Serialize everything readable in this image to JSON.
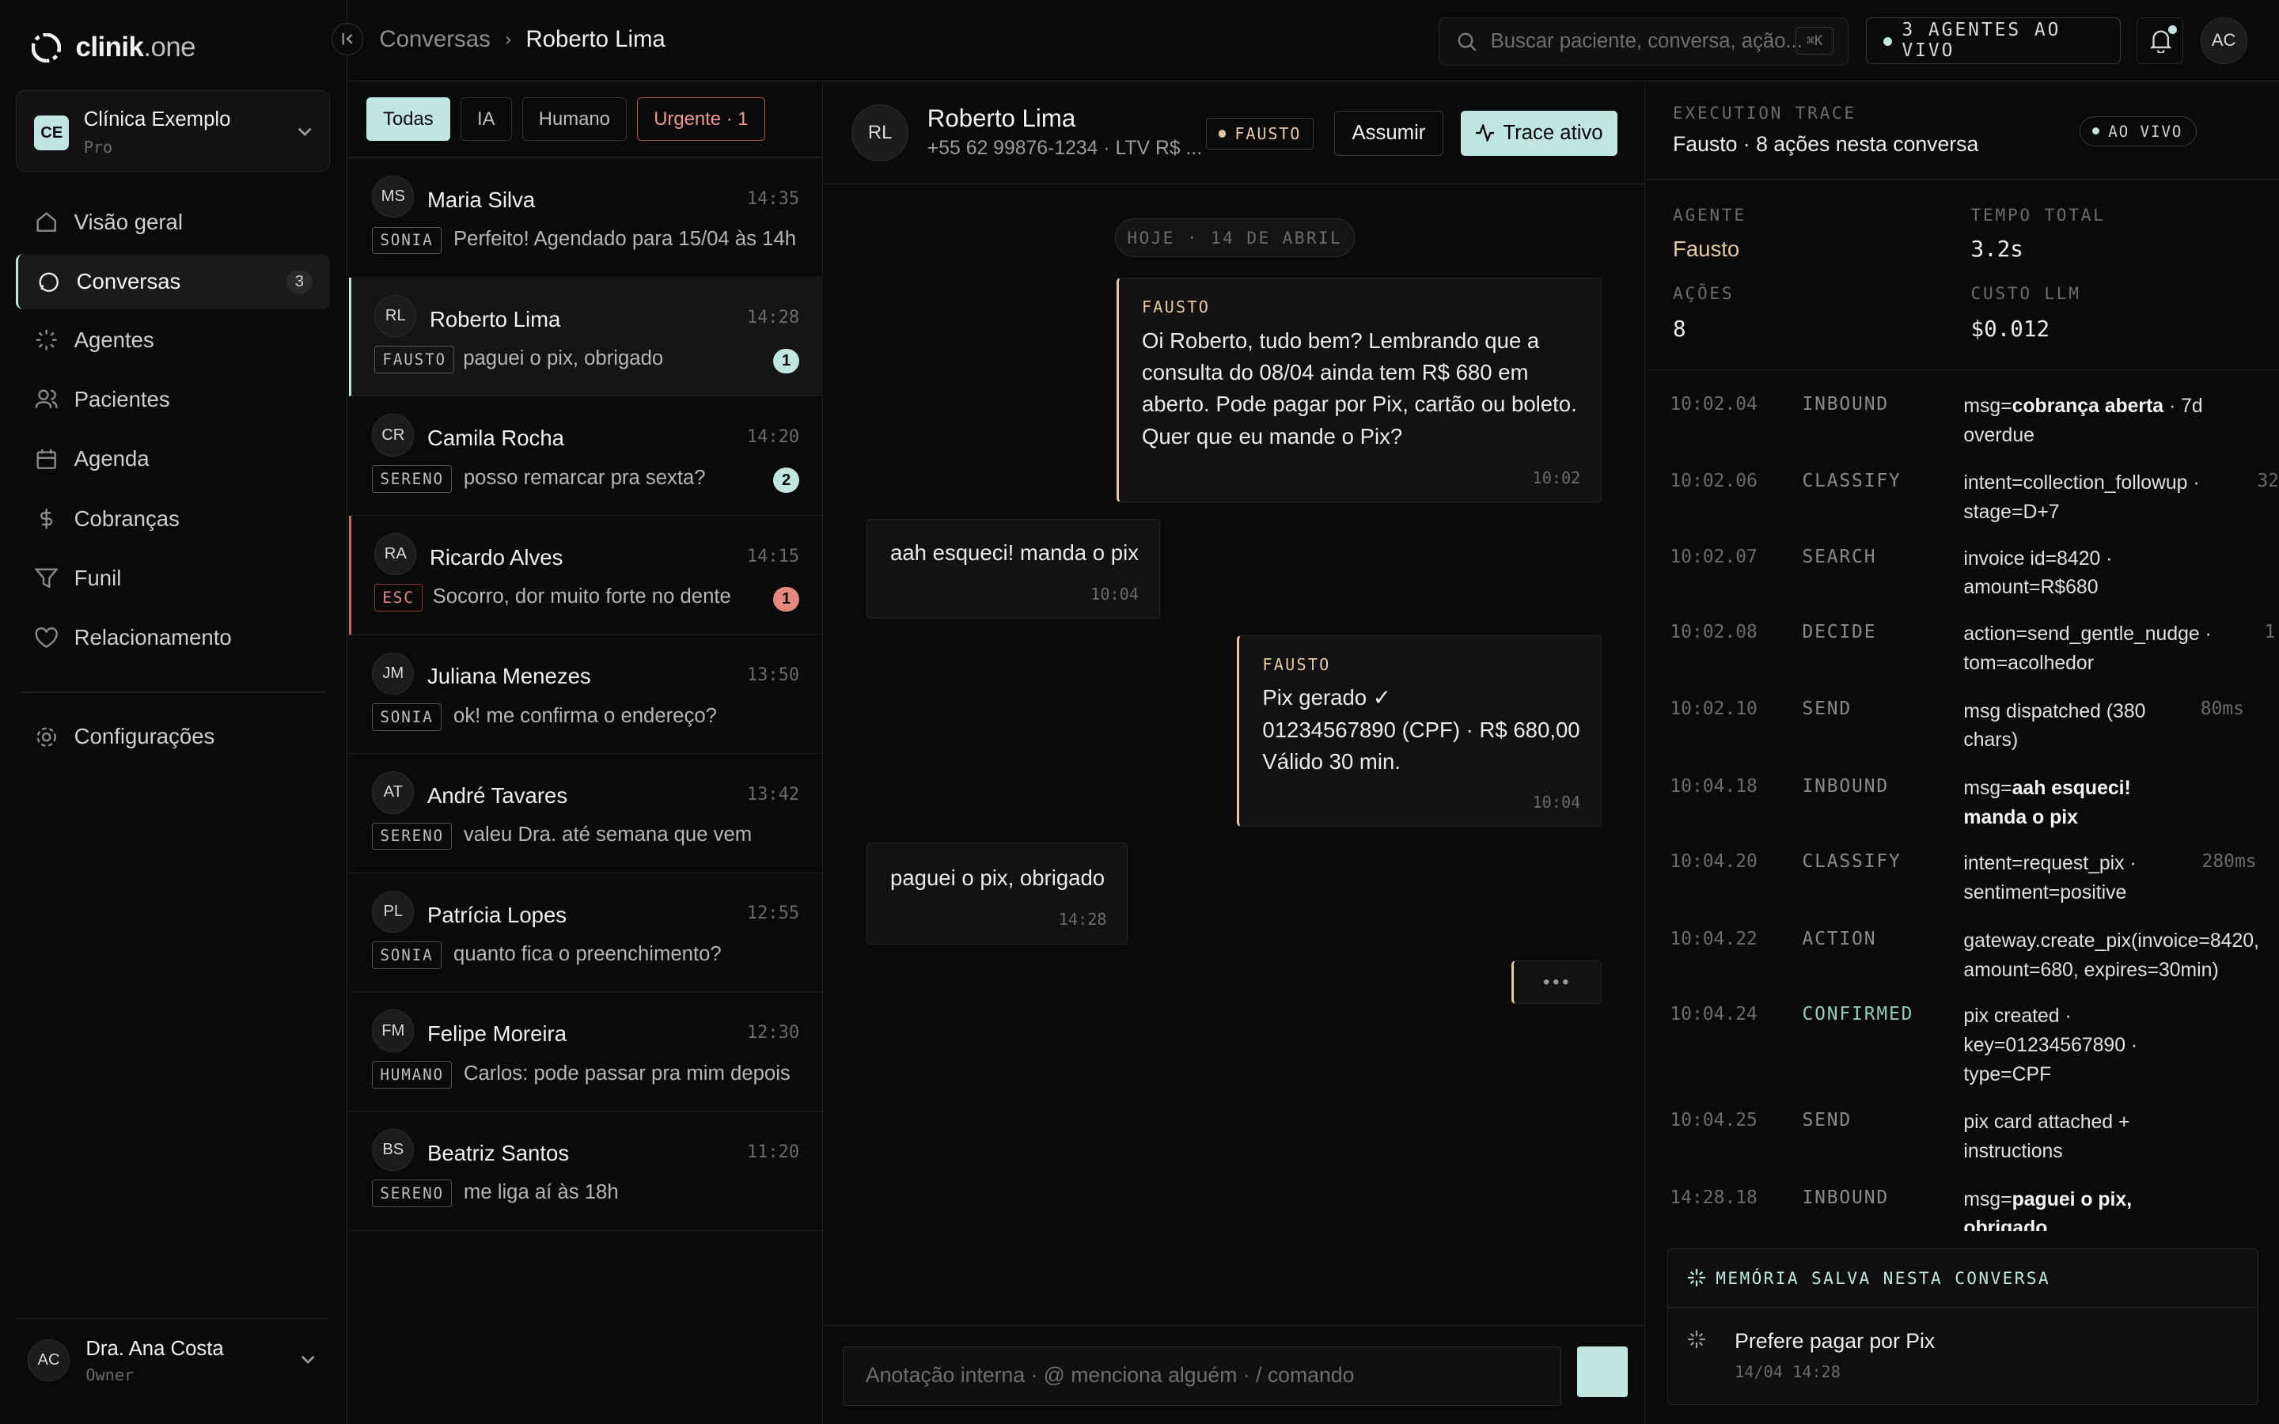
{
  "app": {
    "logo_bold": "clinik",
    "logo_light": ".one"
  },
  "clinic": {
    "initials": "CE",
    "name": "Clínica Exemplo",
    "plan": "Pro"
  },
  "nav": [
    {
      "label": "Visão geral",
      "icon": "home-icon"
    },
    {
      "label": "Conversas",
      "icon": "chat-icon",
      "count": "3",
      "active": true
    },
    {
      "label": "Agentes",
      "icon": "agents-icon"
    },
    {
      "label": "Pacientes",
      "icon": "users-icon"
    },
    {
      "label": "Agenda",
      "icon": "calendar-icon"
    },
    {
      "label": "Cobranças",
      "icon": "dollar-icon"
    },
    {
      "label": "Funil",
      "icon": "filter-icon"
    },
    {
      "label": "Relacionamento",
      "icon": "heart-icon"
    },
    {
      "label": "Configurações",
      "icon": "gear-icon"
    }
  ],
  "user": {
    "initials": "AC",
    "name": "Dra. Ana Costa",
    "role": "Owner"
  },
  "breadcrumb": {
    "root": "Conversas",
    "sep": "›",
    "current": "Roberto Lima"
  },
  "search": {
    "placeholder": "Buscar paciente, conversa, ação...",
    "shortcut": "⌘K"
  },
  "live_agents": "3 AGENTES AO VIVO",
  "top_avatar": "AC",
  "filters": {
    "all": "Todas",
    "ai": "IA",
    "human": "Humano",
    "urgent": "Urgente · 1"
  },
  "conversations": [
    {
      "initials": "MS",
      "name": "Maria Silva",
      "time": "14:35",
      "tag": "SONIA",
      "preview": "Perfeito! Agendado para 15/04 às 14h",
      "badge": ""
    },
    {
      "initials": "RL",
      "name": "Roberto Lima",
      "time": "14:28",
      "tag": "FAUSTO",
      "preview": "paguei o pix, obrigado",
      "badge": "1"
    },
    {
      "initials": "CR",
      "name": "Camila Rocha",
      "time": "14:20",
      "tag": "SERENO",
      "preview": "posso remarcar pra sexta?",
      "badge": "2"
    },
    {
      "initials": "RA",
      "name": "Ricardo Alves",
      "time": "14:15",
      "tag": "ESC",
      "preview": "Socorro, dor muito forte no dente",
      "badge": "1"
    },
    {
      "initials": "JM",
      "name": "Juliana Menezes",
      "time": "13:50",
      "tag": "SONIA",
      "preview": "ok! me confirma o endereço?",
      "badge": ""
    },
    {
      "initials": "AT",
      "name": "André Tavares",
      "time": "13:42",
      "tag": "SERENO",
      "preview": "valeu Dra. até semana que vem",
      "badge": ""
    },
    {
      "initials": "PL",
      "name": "Patrícia Lopes",
      "time": "12:55",
      "tag": "SONIA",
      "preview": "quanto fica o preenchimento?",
      "badge": ""
    },
    {
      "initials": "FM",
      "name": "Felipe Moreira",
      "time": "12:30",
      "tag": "HUMANO",
      "preview": "Carlos: pode passar pra mim depois",
      "badge": ""
    },
    {
      "initials": "BS",
      "name": "Beatriz Santos",
      "time": "11:20",
      "tag": "SERENO",
      "preview": "me liga aí às 18h",
      "badge": ""
    }
  ],
  "chat": {
    "initials": "RL",
    "name": "Roberto Lima",
    "sub": "+55 62 99876-1234 · LTV R$ ...",
    "agent_tag": "FAUSTO",
    "assume": "Assumir",
    "trace_btn": "Trace ativo",
    "day": "HOJE · 14 DE ABRIL",
    "m1": {
      "who": "FAUSTO",
      "l1": "Oi Roberto, tudo bem? Lembrando que a",
      "l2": "consulta do 08/04 ainda tem R$ 680 em",
      "l3": "aberto. Pode pagar por Pix, cartão ou boleto.",
      "l4": "Quer que eu mande o Pix?",
      "time": "10:02"
    },
    "m2": {
      "text": "aah esqueci! manda o pix",
      "time": "10:04"
    },
    "m3": {
      "who": "FAUSTO",
      "l1": "Pix gerado ✓",
      "l2": "01234567890 (CPF) · R$ 680,00",
      "l3": "Válido 30 min.",
      "time": "10:04"
    },
    "m4": {
      "text": "paguei o pix, obrigado",
      "time": "14:28"
    },
    "typing": "•••",
    "composer_placeholder": "Anotação interna · @ menciona alguém · / comando"
  },
  "trace": {
    "label": "EXECUTION TRACE",
    "title": "Fausto · 8 ações nesta conversa",
    "live": "AO VIVO",
    "agent_lbl": "AGENTE",
    "agent": "Fausto",
    "time_lbl": "TEMPO TOTAL",
    "time": "3.2s",
    "actions_lbl": "AÇÕES",
    "actions": "8",
    "cost_lbl": "CUSTO LLM",
    "cost": "$0.012",
    "rows": [
      {
        "ts": "10:02.04",
        "kind": "INBOUND",
        "pre": "msg=",
        "bold": "cobrança aberta",
        "post": " · 7d overdue",
        "ms": ""
      },
      {
        "ts": "10:02.06",
        "kind": "CLASSIFY",
        "pre": "intent=collection_followup · stage=D+7",
        "bold": "",
        "post": "",
        "ms": "32"
      },
      {
        "ts": "10:02.07",
        "kind": "SEARCH",
        "pre": "invoice id=8420 · amount=R$680",
        "bold": "",
        "post": "",
        "ms": ""
      },
      {
        "ts": "10:02.08",
        "kind": "DECIDE",
        "pre": "action=send_gentle_nudge · tom=acolhedor",
        "bold": "",
        "post": "",
        "ms": "1"
      },
      {
        "ts": "10:02.10",
        "kind": "SEND",
        "pre": "msg dispatched (380 chars)",
        "bold": "",
        "post": "",
        "ms": "80ms"
      },
      {
        "ts": "10:04.18",
        "kind": "INBOUND",
        "pre": "msg=",
        "bold": "aah esqueci! manda o pix",
        "post": "",
        "ms": ""
      },
      {
        "ts": "10:04.20",
        "kind": "CLASSIFY",
        "pre": "intent=request_pix · sentiment=positive",
        "bold": "",
        "post": "",
        "ms": "280ms"
      },
      {
        "ts": "10:04.22",
        "kind": "ACTION",
        "pre": "gateway.create_pix(invoice=8420, amount=680, expires=30min)",
        "bold": "",
        "post": "",
        "ms": ""
      },
      {
        "ts": "10:04.24",
        "kind": "CONFIRMED",
        "pre": "pix created · key=01234567890 · type=CPF",
        "bold": "",
        "post": "",
        "ms": ""
      },
      {
        "ts": "10:04.25",
        "kind": "SEND",
        "pre": "pix card attached + instructions",
        "bold": "",
        "post": "",
        "ms": ""
      },
      {
        "ts": "14:28.18",
        "kind": "INBOUND",
        "pre": "msg=",
        "bold": "paguei o pix, obrigado",
        "post": "",
        "ms": ""
      }
    ],
    "memory_lbl": "MEMÓRIA SALVA NESTA CONVERSA",
    "memory_text": "Prefere pagar por Pix",
    "memory_time": "14/04 14:28"
  }
}
